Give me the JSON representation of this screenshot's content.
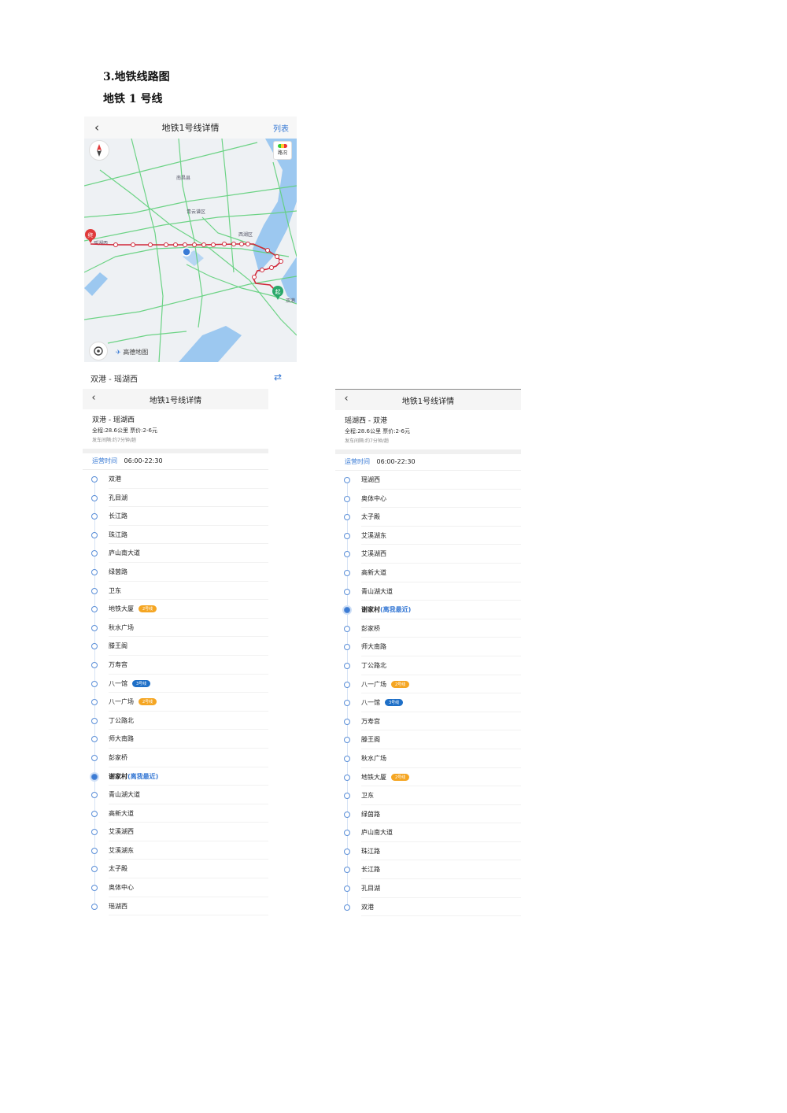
{
  "doc": {
    "section_heading": "3.地铁线路图",
    "line_heading": "地铁 1 号线"
  },
  "map_screen": {
    "title": "地铁1号线详情",
    "list_label": "列表",
    "traffic_label": "路况",
    "logo_text": "高德地图",
    "map_labels": [
      "南昌县",
      "青云谱区",
      "西湖区",
      "瑶湖西",
      "双港"
    ],
    "end_marker": "终",
    "start_marker": "起",
    "route_text": "双港 - 瑶湖西",
    "route_color": "#d0293a",
    "road_color": "#5fd07a",
    "water_color": "#9cc8f0"
  },
  "panels": [
    {
      "title": "地铁1号线详情",
      "direction": "双港 - 瑶湖西",
      "meta": "全程:28.6公里   票价:2-6元",
      "interval": "发车间隔:约7分钟/趟",
      "hours_label": "运营时间",
      "hours": "06:00-22:30",
      "stations": [
        {
          "name": "双港"
        },
        {
          "name": "孔目湖"
        },
        {
          "name": "长江路"
        },
        {
          "name": "珠江路"
        },
        {
          "name": "庐山南大道"
        },
        {
          "name": "绿茵路"
        },
        {
          "name": "卫东"
        },
        {
          "name": "地铁大厦",
          "badge": "2号线",
          "badge_color": "#f5a623"
        },
        {
          "name": "秋水广场"
        },
        {
          "name": "滕王阁"
        },
        {
          "name": "万寿宫"
        },
        {
          "name": "八一馆",
          "badge": "3号线",
          "badge_color": "#1e6fc7"
        },
        {
          "name": "八一广场",
          "badge": "2号线",
          "badge_color": "#f5a623"
        },
        {
          "name": "丁公路北"
        },
        {
          "name": "师大南路"
        },
        {
          "name": "彭家桥"
        },
        {
          "name": "谢家村",
          "near": "(离我最近)",
          "current": true
        },
        {
          "name": "青山湖大道"
        },
        {
          "name": "高新大道"
        },
        {
          "name": "艾溪湖西"
        },
        {
          "name": "艾溪湖东"
        },
        {
          "name": "太子殿"
        },
        {
          "name": "奥体中心"
        },
        {
          "name": "瑶湖西"
        }
      ]
    },
    {
      "title": "地铁1号线详情",
      "direction": "瑶湖西 - 双港",
      "meta": "全程:28.6公里   票价:2-6元",
      "interval": "发车间隔:约7分钟/趟",
      "hours_label": "运营时间",
      "hours": "06:00-22:30",
      "stations": [
        {
          "name": "瑶湖西"
        },
        {
          "name": "奥体中心"
        },
        {
          "name": "太子殿"
        },
        {
          "name": "艾溪湖东"
        },
        {
          "name": "艾溪湖西"
        },
        {
          "name": "高新大道"
        },
        {
          "name": "青山湖大道"
        },
        {
          "name": "谢家村",
          "near": "(离我最近)",
          "current": true
        },
        {
          "name": "彭家桥"
        },
        {
          "name": "师大南路"
        },
        {
          "name": "丁公路北"
        },
        {
          "name": "八一广场",
          "badge": "2号线",
          "badge_color": "#f5a623"
        },
        {
          "name": "八一馆",
          "badge": "3号线",
          "badge_color": "#1e6fc7"
        },
        {
          "name": "万寿宫"
        },
        {
          "name": "滕王阁"
        },
        {
          "name": "秋水广场"
        },
        {
          "name": "地铁大厦",
          "badge": "2号线",
          "badge_color": "#f5a623"
        },
        {
          "name": "卫东"
        },
        {
          "name": "绿茵路"
        },
        {
          "name": "庐山南大道"
        },
        {
          "name": "珠江路"
        },
        {
          "name": "长江路"
        },
        {
          "name": "孔目湖"
        },
        {
          "name": "双港"
        }
      ]
    }
  ]
}
